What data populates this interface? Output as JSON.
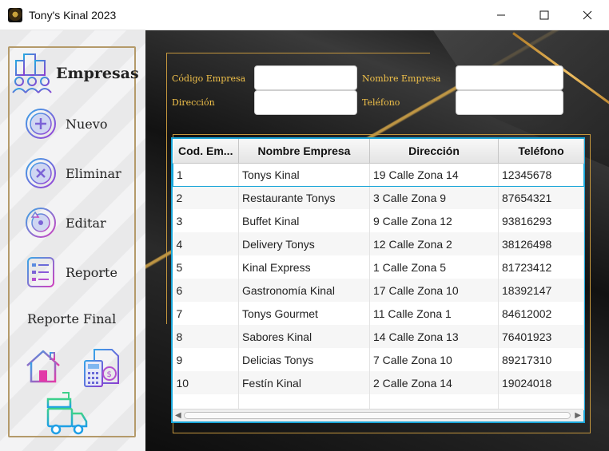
{
  "window": {
    "title": "Tony's Kinal 2023"
  },
  "sidebar": {
    "title": "Empresas",
    "buttons": [
      {
        "label": "Nuevo",
        "icon": "add-icon"
      },
      {
        "label": "Eliminar",
        "icon": "delete-icon"
      },
      {
        "label": "Editar",
        "icon": "edit-icon"
      },
      {
        "label": "Reporte",
        "icon": "report-icon"
      }
    ],
    "report_final_label": "Reporte Final"
  },
  "form": {
    "codigo_label": "Código Empresa",
    "nombre_label": "Nombre Empresa",
    "direccion_label": "Dirección",
    "telefono_label": "Teléfono",
    "codigo_value": "",
    "nombre_value": "",
    "direccion_value": "",
    "telefono_value": ""
  },
  "table": {
    "columns": [
      "Cod. Em...",
      "Nombre Empresa",
      "Dirección",
      "Teléfono"
    ],
    "rows": [
      [
        "1",
        "Tonys Kinal",
        "19 Calle Zona 14",
        "12345678"
      ],
      [
        "2",
        "Restaurante Tonys",
        "3 Calle Zona 9",
        "87654321"
      ],
      [
        "3",
        "Buffet Kinal",
        "9 Calle Zona 12",
        "93816293"
      ],
      [
        "4",
        "Delivery Tonys",
        "12 Calle Zona 2",
        "38126498"
      ],
      [
        "5",
        "Kinal Express",
        "1 Calle Zona 5",
        "81723412"
      ],
      [
        "6",
        "Gastronomía Kinal",
        "17 Calle Zona 10",
        "18392147"
      ],
      [
        "7",
        "Tonys Gourmet",
        "11 Calle Zona 1",
        "84612002"
      ],
      [
        "8",
        "Sabores Kinal",
        "14 Calle Zona 13",
        "76401923"
      ],
      [
        "9",
        "Delicias Tonys",
        "7 Calle Zona 10",
        "89217310"
      ],
      [
        "10",
        "Festín Kinal",
        "2 Calle Zona 14",
        "19024018"
      ]
    ],
    "selected_row": 0
  },
  "colors": {
    "accent_gold": "#f2c24a",
    "table_border": "#19a5d8"
  }
}
